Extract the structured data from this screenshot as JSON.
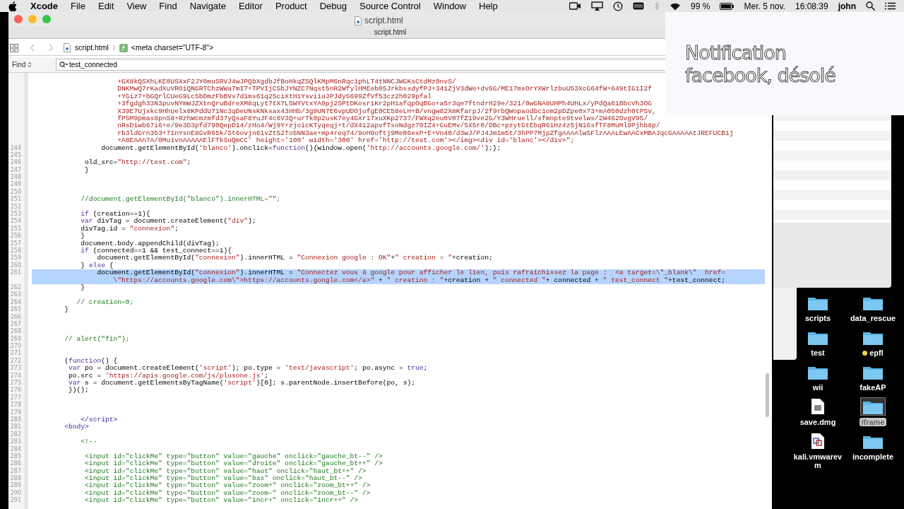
{
  "menu_bar": {
    "app": "Xcode",
    "menus": [
      "File",
      "Edit",
      "View",
      "Find",
      "Navigate",
      "Editor",
      "Product",
      "Debug",
      "Source Control",
      "Window",
      "Help"
    ],
    "battery": "99 %",
    "date": "Mer. 5 nov.",
    "time": "16:08:39",
    "user": "john"
  },
  "window": {
    "title": "script.html"
  },
  "tabs": [
    {
      "label": "script.html",
      "selected": true
    }
  ],
  "jump_bar": {
    "file": "script.html",
    "symbol": "<meta charset=\"UTF-8\">"
  },
  "find_bar": {
    "mode": "Find",
    "value": "test_connected"
  },
  "editor": {
    "lines": [
      {
        "highlighted": false,
        "segments": [
          {
            "kind": "string",
            "text": "                     +GX8kQSXhLKE0USXxF2JY0muSRVJ4wJPQbXgdbJfBoHkqZSQlKMpM6nRqc1phLT4tNNCJWGKsCtdMz0nvS/"
          }
        ]
      },
      {
        "highlighted": false,
        "segments": [
          {
            "kind": "string",
            "text": "                     DNKMwQ7rKadXuVROiQNGRTChzWWa7mI7+TPVIjCSbJYNZC7Nqst5nR2WfylHMEeb05JrkbssdyfPJ+341ZjV3dWe+dv6G/ME17msOrYXWrlzbuU53XcG64fW+649tIG1I2f"
          }
        ]
      },
      {
        "highlighted": false,
        "segments": [
          {
            "kind": "string",
            "text": "                     +YGiz7+bGQrlCUeG9Lc5bDmzFbBVs7d1ms61q25ciXtH1YsviiuJPJdyS699ZfVf53cz2h029pfal"
          }
        ]
      },
      {
        "highlighted": false,
        "segments": [
          {
            "kind": "string",
            "text": "                     +3fgdgh33N3puvNYmWJZXtnQruBdreXM8qLyt7tX7L5WYVtxYA9pj2SPtDKosr1Kr2pH1afqpOqBGo+a5r3qe7ftndrH29e/321/0wGNA8UHPh4UHLx/yPdQa61BbcVh3OG"
          }
        ]
      },
      {
        "highlighted": false,
        "segments": [
          {
            "kind": "string",
            "text": "                     X39E7Ujxkc9HhUelx8KPddU71Nc3qDeUNsKNksax43HHb/3g9UN7E6vpUDOjufgE0CE58eLH+B/vngw82XmKfarpJ/2f9rbQWopaodbc1om2pDZpe0x73+mA050dzh0tP5v,"
          }
        ]
      },
      {
        "highlighted": false,
        "segments": [
          {
            "kind": "string",
            "text": "                     fPSM9pmas8pnS8+RzhWcmzmfd37yQsaF8YuJF4c6V3Q+urTk0p2usK7ey4GXr17xuXKp2737/FWXq2eu0V07fZ19ve2G/Y3WHruell/sfmnpte9tvelws/2W462OvgV95/"
          }
        ]
      },
      {
        "highlighted": false,
        "segments": [
          {
            "kind": "string",
            "text": "                     nRsDiwb67i6+e/9e3D3pfd790QepD14/zHo4/Wj9Y+zjoicKTyqeqj+t/dX412apvfTsoNdgz70IZ4+GuEMv/5X5r0/DBc+pzytGtEbqR61Hz4z5jN16sfTF8MuMl9Pjhb8p/"
          }
        ]
      },
      {
        "highlighted": false,
        "segments": [
          {
            "kind": "string",
            "text": "                     rb3ldGrn353+71nYsnE8GvR65k/St6ovjn61vZt52To5NN3ae+mp4req74/9oH9oftj9MeR6exP+E+Vn40/d3wJ/PJ4Jm1m5t/3hPP7MjpZfgAAAAlwSFlzAAALEwAACxMBAJqcGAAAAAtJREFUCB1j"
          }
        ]
      },
      {
        "highlighted": false,
        "segments": [
          {
            "kind": "string",
            "text": "                     +A8EAAn7A/0Mu1vnAAAAAElFTkSuQmCC' height='100' width='300' href='http://test.com'></img><div id='blanc'></div>\";"
          }
        ]
      },
      {
        "number": "244",
        "highlighted": false,
        "segments": [
          {
            "kind": "plain",
            "text": "                 document.getElementById("
          },
          {
            "kind": "string",
            "text": "'blanco'"
          },
          {
            "kind": "plain",
            "text": ").onclick="
          },
          {
            "kind": "keyword",
            "text": "function"
          },
          {
            "kind": "plain",
            "text": "(){window.open("
          },
          {
            "kind": "string",
            "text": "'http://accounts.google.com/'"
          },
          {
            "kind": "plain",
            "text": ");};"
          }
        ]
      },
      {
        "number": "245",
        "highlighted": false
      },
      {
        "number": "246",
        "highlighted": false,
        "segments": [
          {
            "kind": "plain",
            "text": "             old_src="
          },
          {
            "kind": "string",
            "text": "\"http://test.com\""
          },
          {
            "kind": "plain",
            "text": ";"
          }
        ]
      },
      {
        "number": "247",
        "highlighted": false,
        "segments": [
          {
            "kind": "plain",
            "text": "             }"
          }
        ]
      },
      {
        "number": "248",
        "highlighted": false
      },
      {
        "number": "249",
        "highlighted": false
      },
      {
        "number": "250",
        "highlighted": false
      },
      {
        "number": "251",
        "highlighted": false,
        "segments": [
          {
            "kind": "comment",
            "text": "            //document.getElementById(\"blanco\").innerHTML=\"\";"
          }
        ]
      },
      {
        "number": "252",
        "highlighted": false
      },
      {
        "number": "253",
        "highlighted": false,
        "segments": [
          {
            "kind": "keyword",
            "text": "            if"
          },
          {
            "kind": "plain",
            "text": " (creation==1){"
          }
        ]
      },
      {
        "number": "254",
        "highlighted": false,
        "segments": [
          {
            "kind": "keyword",
            "text": "            var"
          },
          {
            "kind": "plain",
            "text": " divTag = document.createElement("
          },
          {
            "kind": "string",
            "text": "\"div\""
          },
          {
            "kind": "plain",
            "text": ");"
          }
        ]
      },
      {
        "number": "255",
        "highlighted": false,
        "segments": [
          {
            "kind": "plain",
            "text": "            divTag.id = "
          },
          {
            "kind": "string",
            "text": "\"connexion\""
          },
          {
            "kind": "plain",
            "text": ";"
          }
        ]
      },
      {
        "number": "256",
        "highlighted": false,
        "segments": [
          {
            "kind": "plain",
            "text": "            }"
          }
        ]
      },
      {
        "number": "257",
        "highlighted": false,
        "segments": [
          {
            "kind": "plain",
            "text": "            document.body.appendChild(divTag);"
          }
        ]
      },
      {
        "number": "258",
        "highlighted": false,
        "segments": [
          {
            "kind": "keyword",
            "text": "            if"
          },
          {
            "kind": "plain",
            "text": " (connected==1 && test_connect==1){"
          }
        ]
      },
      {
        "number": "259",
        "highlighted": false,
        "segments": [
          {
            "kind": "plain",
            "text": "                document.getElementById("
          },
          {
            "kind": "string",
            "text": "\"connexion\""
          },
          {
            "kind": "plain",
            "text": ").innerHTML = "
          },
          {
            "kind": "string",
            "text": "\"Connexion google : OK\""
          },
          {
            "kind": "plain",
            "text": "+"
          },
          {
            "kind": "string",
            "text": "\" creation = \""
          },
          {
            "kind": "plain",
            "text": "+creation;"
          }
        ]
      },
      {
        "number": "260",
        "highlighted": false,
        "segments": [
          {
            "kind": "plain",
            "text": "            } "
          },
          {
            "kind": "keyword",
            "text": "else"
          },
          {
            "kind": "plain",
            "text": " {"
          }
        ]
      },
      {
        "number": "261",
        "highlighted": true,
        "segments": [
          {
            "kind": "plain",
            "text": "                document.getElementById("
          },
          {
            "kind": "string",
            "text": "\"connexion\""
          },
          {
            "kind": "plain",
            "text": ").innerHTML = "
          },
          {
            "kind": "string",
            "text": "\"Connectez vous à google pour afficher le lien, puis rafraichissez la page :  <a target=\\\"_blank\\\"  href="
          }
        ]
      },
      {
        "highlighted": true,
        "segments": [
          {
            "kind": "string",
            "text": "                    \\\"https://accounts.google.com\\\">https://accounts.google.com</a>\""
          },
          {
            "kind": "plain",
            "text": " + "
          },
          {
            "kind": "string",
            "text": "\" creation : \""
          },
          {
            "kind": "plain",
            "text": "+creation + "
          },
          {
            "kind": "string",
            "text": "\" connected \""
          },
          {
            "kind": "plain",
            "text": "+ connected + "
          },
          {
            "kind": "string",
            "text": "\" test_connect \""
          },
          {
            "kind": "plain",
            "text": "+test_connect;"
          }
        ]
      },
      {
        "number": "262",
        "highlighted": false,
        "segments": [
          {
            "kind": "plain",
            "text": "            }"
          }
        ]
      },
      {
        "number": "263",
        "highlighted": false
      },
      {
        "number": "264",
        "highlighted": false,
        "segments": [
          {
            "kind": "comment",
            "text": "           // creation=0;"
          }
        ]
      },
      {
        "number": "265",
        "highlighted": false,
        "segments": [
          {
            "kind": "plain",
            "text": "        }"
          }
        ]
      },
      {
        "number": "266",
        "highlighted": false
      },
      {
        "number": "267",
        "highlighted": false
      },
      {
        "number": "268",
        "highlighted": false
      },
      {
        "number": "269",
        "highlighted": false,
        "segments": [
          {
            "kind": "comment",
            "text": "        // alert(\"fin\");"
          }
        ]
      },
      {
        "number": "270",
        "highlighted": false
      },
      {
        "number": "271",
        "highlighted": false
      },
      {
        "number": "272",
        "highlighted": false,
        "segments": [
          {
            "kind": "plain",
            "text": "        ("
          },
          {
            "kind": "keyword",
            "text": "function"
          },
          {
            "kind": "plain",
            "text": "() {"
          }
        ]
      },
      {
        "number": "273",
        "highlighted": false,
        "segments": [
          {
            "kind": "keyword",
            "text": "         var"
          },
          {
            "kind": "plain",
            "text": " po = document.createElement("
          },
          {
            "kind": "string",
            "text": "'script'"
          },
          {
            "kind": "plain",
            "text": "); po.type = "
          },
          {
            "kind": "string",
            "text": "'text/javascript'"
          },
          {
            "kind": "plain",
            "text": "; po.async = "
          },
          {
            "kind": "keyword",
            "text": "true"
          },
          {
            "kind": "plain",
            "text": ";"
          }
        ]
      },
      {
        "number": "274",
        "highlighted": false,
        "segments": [
          {
            "kind": "plain",
            "text": "         po.src = "
          },
          {
            "kind": "string",
            "text": "'https://apis.google.com/js/plusone.js'"
          },
          {
            "kind": "plain",
            "text": ";"
          }
        ]
      },
      {
        "number": "275",
        "highlighted": false,
        "segments": [
          {
            "kind": "keyword",
            "text": "         var"
          },
          {
            "kind": "plain",
            "text": " s = document.getElementsByTagName("
          },
          {
            "kind": "string",
            "text": "'script'"
          },
          {
            "kind": "plain",
            "text": ")[0]; s.parentNode.insertBefore(po, s);"
          }
        ]
      },
      {
        "number": "276",
        "highlighted": false,
        "segments": [
          {
            "kind": "plain",
            "text": "         })();"
          }
        ]
      },
      {
        "number": "277",
        "highlighted": false
      },
      {
        "number": "278",
        "highlighted": false
      },
      {
        "number": "279",
        "highlighted": false
      },
      {
        "number": "280",
        "highlighted": false,
        "segments": [
          {
            "kind": "tag",
            "text": "            </script>"
          }
        ]
      },
      {
        "number": "281",
        "highlighted": false,
        "segments": [
          {
            "kind": "tag",
            "text": "        <body>"
          }
        ]
      },
      {
        "number": "282",
        "highlighted": false
      },
      {
        "number": "283",
        "highlighted": false,
        "segments": [
          {
            "kind": "comment",
            "text": "            <!--"
          }
        ]
      },
      {
        "number": "284",
        "highlighted": false
      },
      {
        "number": "285",
        "highlighted": false,
        "segments": [
          {
            "kind": "comment",
            "text": "             <input id=\"clickMe\" type=\"button\" value=\"gauche\" onclick=\"gauche_bt--\" />"
          }
        ]
      },
      {
        "number": "286",
        "highlighted": false,
        "segments": [
          {
            "kind": "comment",
            "text": "             <input id=\"clickMe\" type=\"button\" value=\"droite\" onclick=\"gauche_bt++\" />"
          }
        ]
      },
      {
        "number": "287",
        "highlighted": false,
        "segments": [
          {
            "kind": "comment",
            "text": "             <input id=\"clickMe\" type=\"button\" value=\"haut\" onclick=\"haut_bt++\" />"
          }
        ]
      },
      {
        "number": "288",
        "highlighted": false,
        "segments": [
          {
            "kind": "comment",
            "text": "             <input id=\"clickMe\" type=\"button\" value=\"bas\" onclick=\"haut_bt--\" />"
          }
        ]
      },
      {
        "number": "289",
        "highlighted": false,
        "segments": [
          {
            "kind": "comment",
            "text": "             <input id=\"clickMe\" type=\"button\" value=\"zoom+\" onclick=\"zoom_bt++\" />"
          }
        ]
      },
      {
        "number": "290",
        "highlighted": false,
        "segments": [
          {
            "kind": "comment",
            "text": "             <input id=\"clickMe\" type=\"button\" value=\"zoom-\" onclick=\"zoom_bt--\" />"
          }
        ]
      },
      {
        "number": "291",
        "highlighted": false,
        "segments": [
          {
            "kind": "comment",
            "text": "             <input id=\"clickMe\" type=\"button\" value=\"incr+\" onclick=\"incr++\" />"
          }
        ]
      }
    ]
  },
  "notification": {
    "text": "Notification facebook, désolé"
  },
  "desktop_icons": [
    {
      "label": "scripts",
      "kind": "folder",
      "selected": false
    },
    {
      "label": "data_rescue",
      "kind": "folder",
      "selected": false
    },
    {
      "label": "test",
      "kind": "folder",
      "selected": false
    },
    {
      "label": "epfl",
      "kind": "folder",
      "selected": false,
      "color": "#f4d03f"
    },
    {
      "label": "wii",
      "kind": "folder",
      "selected": false
    },
    {
      "label": "fakeAP",
      "kind": "folder",
      "selected": false
    },
    {
      "label": "save.dmg",
      "kind": "disk-image",
      "selected": false
    },
    {
      "label": "iframe",
      "kind": "folder",
      "selected": true
    },
    {
      "label": "kali.vmwarevm",
      "kind": "vm",
      "selected": false
    },
    {
      "label": "incomplete",
      "kind": "folder",
      "selected": false
    }
  ]
}
